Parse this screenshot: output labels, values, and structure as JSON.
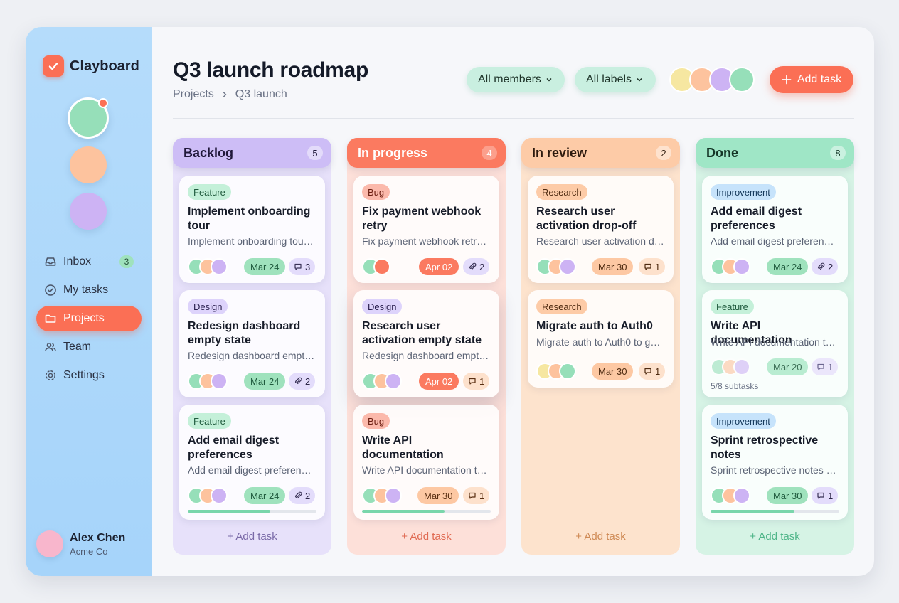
{
  "app": {
    "name": "Clayboard"
  },
  "sidebar": {
    "nav": [
      {
        "label": "Inbox",
        "badge": "3"
      },
      {
        "label": "My tasks"
      },
      {
        "label": "Projects"
      },
      {
        "label": "Team"
      },
      {
        "label": "Settings"
      }
    ],
    "user": {
      "name": "Alex Chen",
      "org": "Acme Co"
    }
  },
  "header": {
    "title": "Q3 launch roadmap",
    "breadcrumb": [
      "Projects",
      "Q3 launch"
    ],
    "filters": [
      "All members",
      "All labels"
    ],
    "add_task_label": "Add task"
  },
  "columns": [
    {
      "title": "Backlog",
      "count": "5",
      "add_label": "Add task",
      "cards": [
        {
          "tag": "Feature",
          "title": "Implement onboarding tour",
          "desc": "Implement onboarding tour…",
          "date": "Mar 24",
          "meta_icon": "comment-icon",
          "meta": "3"
        },
        {
          "tag": "Design",
          "title": "Redesign dashboard empty state",
          "desc": "Redesign dashboard empty…",
          "date": "Mar 24",
          "meta_icon": "paperclip-icon",
          "meta": "2"
        },
        {
          "tag": "Feature",
          "title": "Add email digest preferences",
          "desc": "Add email digest preferenc…",
          "date": "Mar 24",
          "meta_icon": "paperclip-icon",
          "meta": "2",
          "progress": 0.64
        }
      ]
    },
    {
      "title": "In progress",
      "count": "4",
      "add_label": "Add task",
      "cards": [
        {
          "tag": "Bug",
          "title": "Fix payment webhook retry",
          "desc": "Fix payment webhook retry…",
          "date": "Apr 02",
          "meta_icon": "paperclip-icon",
          "meta": "2"
        },
        {
          "tag": "Design",
          "title": "Research user activation empty state",
          "desc": "Redesign dashboard empty…",
          "date": "Apr 02",
          "meta_icon": "comment-icon",
          "meta": "1"
        },
        {
          "tag": "Bug",
          "title": "Write API documentation",
          "desc": "Write API documentation to…",
          "date": "Mar 30",
          "meta_icon": "comment-icon",
          "meta": "1",
          "progress": 0.64
        }
      ]
    },
    {
      "title": "In review",
      "count": "2",
      "add_label": "Add task",
      "cards": [
        {
          "tag": "Research",
          "title": "Research user activation drop-off",
          "desc": "Research user activation dr…",
          "date": "Mar 30",
          "meta_icon": "comment-icon",
          "meta": "1"
        },
        {
          "tag": "Research",
          "title": "Migrate auth to Auth0",
          "desc": "Migrate auth to Auth0 to gx…",
          "date": "Mar 30",
          "meta_icon": "comment-icon",
          "meta": "1"
        }
      ]
    },
    {
      "title": "Done",
      "count": "8",
      "add_label": "Add task",
      "cards": [
        {
          "tag": "Improvement",
          "title": "Add email digest preferences",
          "desc": "Add email digest preferenc…",
          "date": "Mar 24",
          "meta_icon": "paperclip-icon",
          "meta": "2"
        },
        {
          "tag": "Feature",
          "title": "Write API documentation",
          "desc": "Write API documentation to…",
          "date": "Mar 20",
          "meta_icon": "comment-icon",
          "meta": "1",
          "subtasks": "5/8 subtasks"
        },
        {
          "tag": "Improvement",
          "title": "Sprint retrospective notes",
          "desc": "Sprint retrospective notes t…",
          "date": "Mar 30",
          "meta_icon": "comment-icon",
          "meta": "1",
          "progress": 0.65
        }
      ]
    }
  ],
  "colors": {
    "accent": "#fb6f55",
    "sidebar": "#a6d4fa",
    "backlog": "#cdbdf6",
    "in_progress": "#fb7a60",
    "in_review": "#fdcba7",
    "done": "#9fe6c6"
  }
}
